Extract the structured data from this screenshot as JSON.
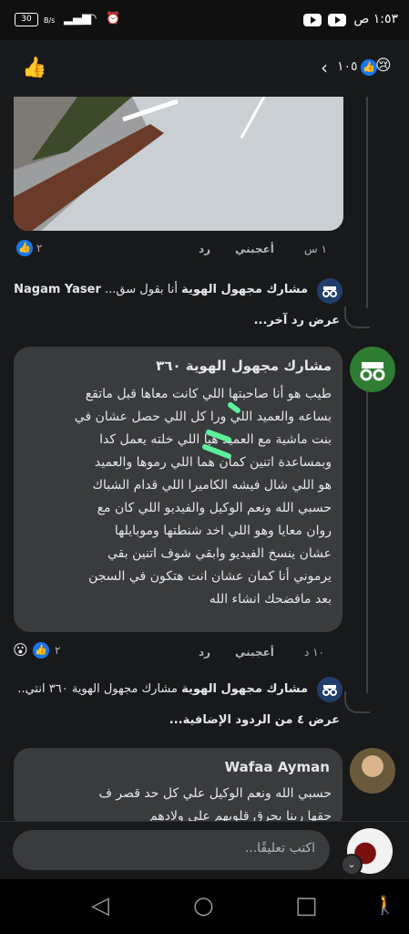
{
  "status_bar": {
    "time": "١:٥٣ ص",
    "battery": "30",
    "net_speed": "B/s"
  },
  "header": {
    "reaction_count": "١٠٥"
  },
  "comment1": {
    "time": "١ س",
    "like": "أعجبني",
    "reply": "رد",
    "reaction_count": "٢"
  },
  "reply_preview1": {
    "author": "مشارك مجهول الهوية",
    "text": "أنا بقول سق...",
    "mention": "Nagam Yaser"
  },
  "view_other_reply": "عرض رد آخر...",
  "comment2": {
    "author": "مشارك مجهول الهوية ٣٦٠",
    "lines": [
      "طيب هو أنا صاحبتها اللي كانت معاها قبل ماتقع",
      "بساعه والعميد اللي ورا كل اللي حصل عشان في",
      "بنت ماشية مع العميد هيا اللي خلته يعمل كدا",
      "وبمساعدة اتنين كمان هما اللي رموها والعميد",
      "هو اللي شال فيشه الكاميرا اللي قدام الشباك",
      "حسبي الله ونعم الوكيل والفيديو اللي كان مع",
      "روان معايا وهو اللي اخد شنطتها وموبايلها",
      "عشان ينسخ الفيديو وابقي شوف اتنين بقي",
      "يرموني أنا كمان عشان انت هتكون في السجن",
      "بعد مافضحك انشاء الله"
    ],
    "time": "١٠ د",
    "like": "أعجبني",
    "reply": "رد",
    "reaction_count": "٢"
  },
  "reply_preview2": {
    "author": "مشارك مجهول الهوية",
    "text": "مشارك مجهول الهوية ٣٦٠ انتي..."
  },
  "view_more_replies": "عرض ٤ من الردود الإضافية...",
  "comment3": {
    "author": "Wafaa Ayman",
    "lines": [
      "حسبي الله ونعم الوكيل علي كل حد قصر ف",
      "حقها ربنا يحرق قلوبهم علي ولادهم"
    ]
  },
  "composer": {
    "placeholder": "اكتب تعليقًا..."
  }
}
